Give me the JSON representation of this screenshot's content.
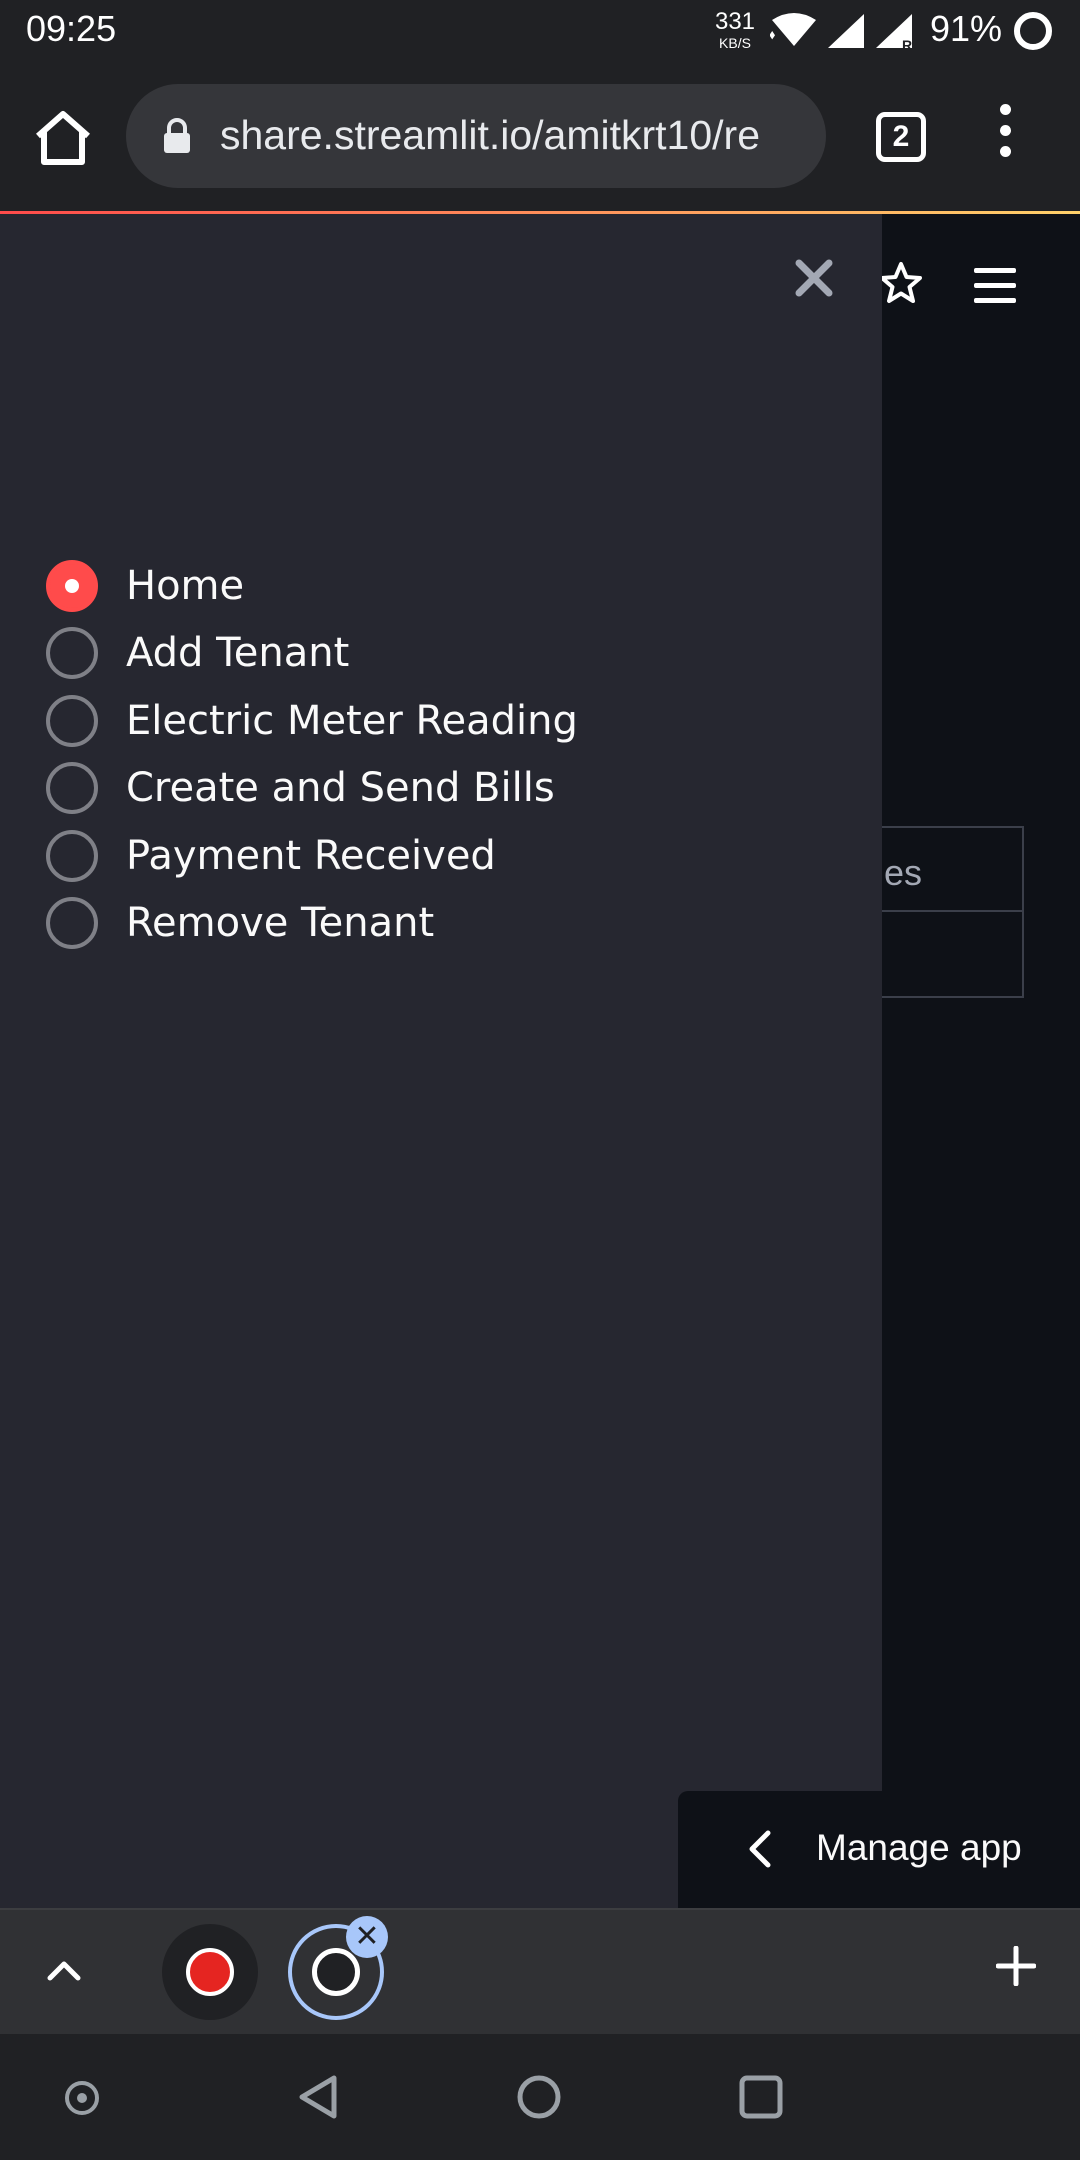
{
  "status_bar": {
    "time": "09:25",
    "net_speed_value": "331",
    "net_speed_unit": "KB/S",
    "battery": "91%"
  },
  "browser": {
    "url": "share.streamlit.io/amitkrt10/re",
    "tab_count": "2"
  },
  "sidebar": {
    "radio_options": [
      {
        "label": "Home",
        "selected": true
      },
      {
        "label": "Add Tenant",
        "selected": false
      },
      {
        "label": "Electric Meter Reading",
        "selected": false
      },
      {
        "label": "Create and Send Bills",
        "selected": false
      },
      {
        "label": "Payment Received",
        "selected": false
      },
      {
        "label": "Remove Tenant",
        "selected": false
      }
    ]
  },
  "main": {
    "table_cell": "es"
  },
  "manage_app": {
    "label": "Manage app"
  },
  "colors": {
    "accent": "#ff4b4b",
    "sidebar_bg": "#262730",
    "main_bg": "#0e1117"
  }
}
